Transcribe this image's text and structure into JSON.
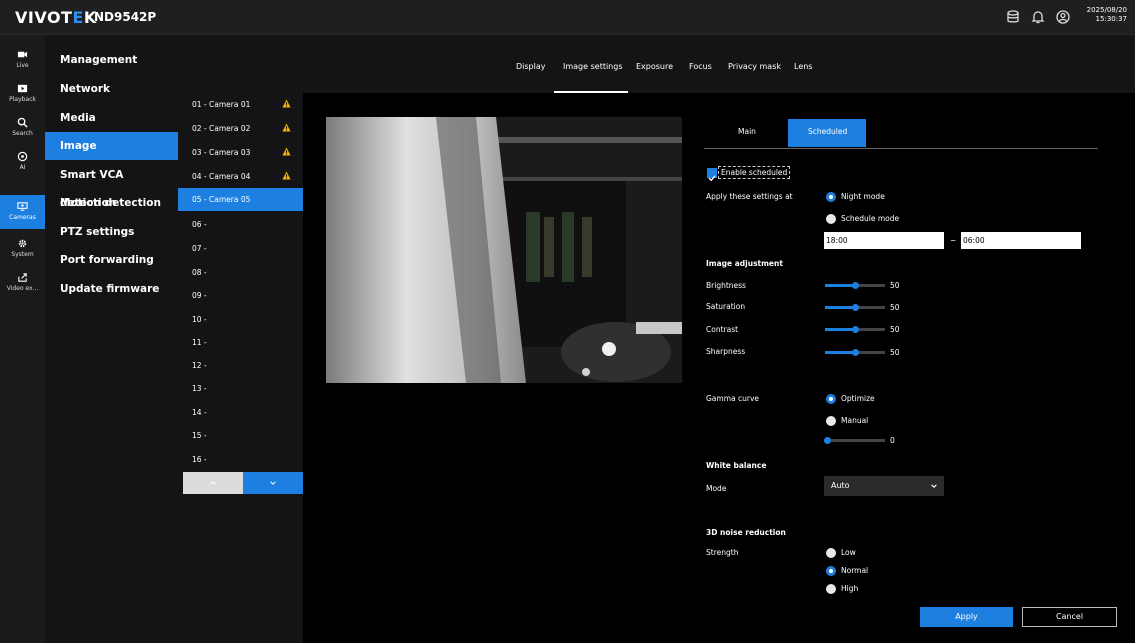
{
  "header": {
    "brand_part1": "VIVOT",
    "brand_part2": "E",
    "brand_part3": "K",
    "model": "ND9542P",
    "date": "2025/08/20",
    "time": "15:30:37"
  },
  "leftnav": {
    "items": [
      {
        "label": "Live",
        "icon": "video-camera-icon"
      },
      {
        "label": "Playback",
        "icon": "play-icon"
      },
      {
        "label": "Search",
        "icon": "search-icon"
      },
      {
        "label": "AI",
        "icon": "ai-icon"
      },
      {
        "label": "Cameras",
        "icon": "cameras-icon"
      },
      {
        "label": "System",
        "icon": "gear-icon"
      },
      {
        "label": "Video ex...",
        "icon": "export-icon"
      }
    ]
  },
  "settings_menu": {
    "items": [
      "Management",
      "Network",
      "Media",
      "Image",
      "Smart VCA detection",
      "Motion detection",
      "PTZ settings",
      "Port forwarding",
      "Update firmware"
    ],
    "active": "Image"
  },
  "tabs": {
    "items": [
      "Display",
      "Image settings",
      "Exposure",
      "Focus",
      "Privacy mask",
      "Lens"
    ],
    "active": "Image settings"
  },
  "cameras": {
    "items": [
      "01 - Camera 01",
      "02 - Camera 02",
      "03 - Camera 03",
      "04 - Camera 04",
      "05 - Camera 05",
      "06 -",
      "07 -",
      "08 -",
      "09 -",
      "10 -",
      "11 -",
      "12 -",
      "13 -",
      "14 -",
      "15 -",
      "16 -"
    ],
    "active": "05 - Camera 05",
    "warning_color": "#f5b400"
  },
  "panel": {
    "subtabs": [
      "Main",
      "Scheduled"
    ],
    "active_subtab": "Scheduled",
    "enable_scheduled_label": "Enable scheduled",
    "enable_scheduled_checked": true,
    "apply_at_label": "Apply these settings at",
    "night_mode_label": "Night mode",
    "schedule_mode_label": "Schedule mode",
    "selected_mode": "Night mode",
    "time_from": "18:00",
    "time_separator": "~",
    "time_to": "06:00",
    "image_adjustment_header": "Image adjustment",
    "adjustments": [
      {
        "label": "Brightness",
        "value": "50"
      },
      {
        "label": "Saturation",
        "value": "50"
      },
      {
        "label": "Contrast",
        "value": "50"
      },
      {
        "label": "Sharpness",
        "value": "50"
      }
    ],
    "gamma_label": "Gamma curve",
    "gamma_optimize": "Optimize",
    "gamma_manual": "Manual",
    "gamma_selected": "Optimize",
    "gamma_value": "0",
    "white_balance_header": "White balance",
    "mode_label": "Mode",
    "mode_value": "Auto",
    "noise_header": "3D noise reduction",
    "strength_label": "Strength",
    "strength_options": [
      "Low",
      "Normal",
      "High"
    ],
    "strength_selected": "Normal",
    "apply_label": "Apply",
    "cancel_label": "Cancel"
  },
  "colors": {
    "accent": "#1d7fe0",
    "bg": "#000000",
    "panel_bg": "#141416"
  }
}
